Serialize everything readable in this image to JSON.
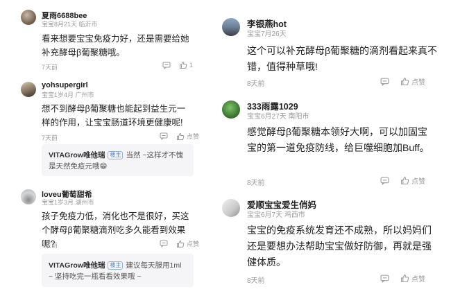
{
  "left": {
    "comments": [
      {
        "name": "夏雨6688bee",
        "meta": "宝宝8月21天  临沂市",
        "body": "看来想要宝宝免疫力好，还是需要给她补充酵母β葡聚糖哦。",
        "time": "7天前",
        "like": "1"
      },
      {
        "name": "yohsupergirl",
        "meta": "宝宝1岁4月  广州市",
        "body": "想不到酵母β葡聚糖也能起到益生元一样的作用，让宝宝肠道环境更健康呢!",
        "time": "7天前",
        "like": "点赞",
        "reply": {
          "name": "VITAGrow唯他瑞",
          "badge": "楼主",
          "text": "当然 ~这样才不愧是天然免疫元哦😁"
        }
      },
      {
        "name": "loveu葡萄甜希",
        "meta": "宝宝1岁3月  湖州市",
        "body": "孩子免疫力低，消化也不是很好，买这个酵母β葡聚糖滴剂吃多久能看到效果呢?",
        "time": "7天前",
        "like": "点赞",
        "reply": {
          "name": "VITAGrow唯他瑞",
          "badge": "楼主",
          "text": "建议每天服用1ml ~ 坚持吃完一瓶看看效果哦 ~"
        }
      }
    ]
  },
  "right": {
    "comments": [
      {
        "name": "李银燕hot",
        "meta": "宝宝7月26天",
        "body": "这个可以补充酵母β葡聚糖的滴剂看起来真不错，值得种草哦!",
        "time": "8天前",
        "like": "点赞"
      },
      {
        "name": "333雨露1029",
        "meta": "宝宝6月27天  南阳市",
        "body": "感觉酵母β葡聚糖本领好大啊，可以加固宝宝的第一道免疫防线，给巨噬细胞加Buff。",
        "time": "8天前",
        "like": "点赞"
      },
      {
        "name": "爱顺宝宝爱生俏妈",
        "meta": "宝宝6月7天  鸡西市",
        "body": "宝宝的免疫系统发育还不成熟，所以妈妈们还是要想办法帮助宝宝做好防御，再就是强健体质。",
        "time": "8天前",
        "like": "点赞"
      }
    ]
  },
  "colors": {
    "meta": "#9a9a9a",
    "reply_bg": "#f5f5f7",
    "badge": "#5b86c0"
  },
  "icons": {
    "comment": "comment-icon",
    "like": "thumb-up-icon"
  }
}
